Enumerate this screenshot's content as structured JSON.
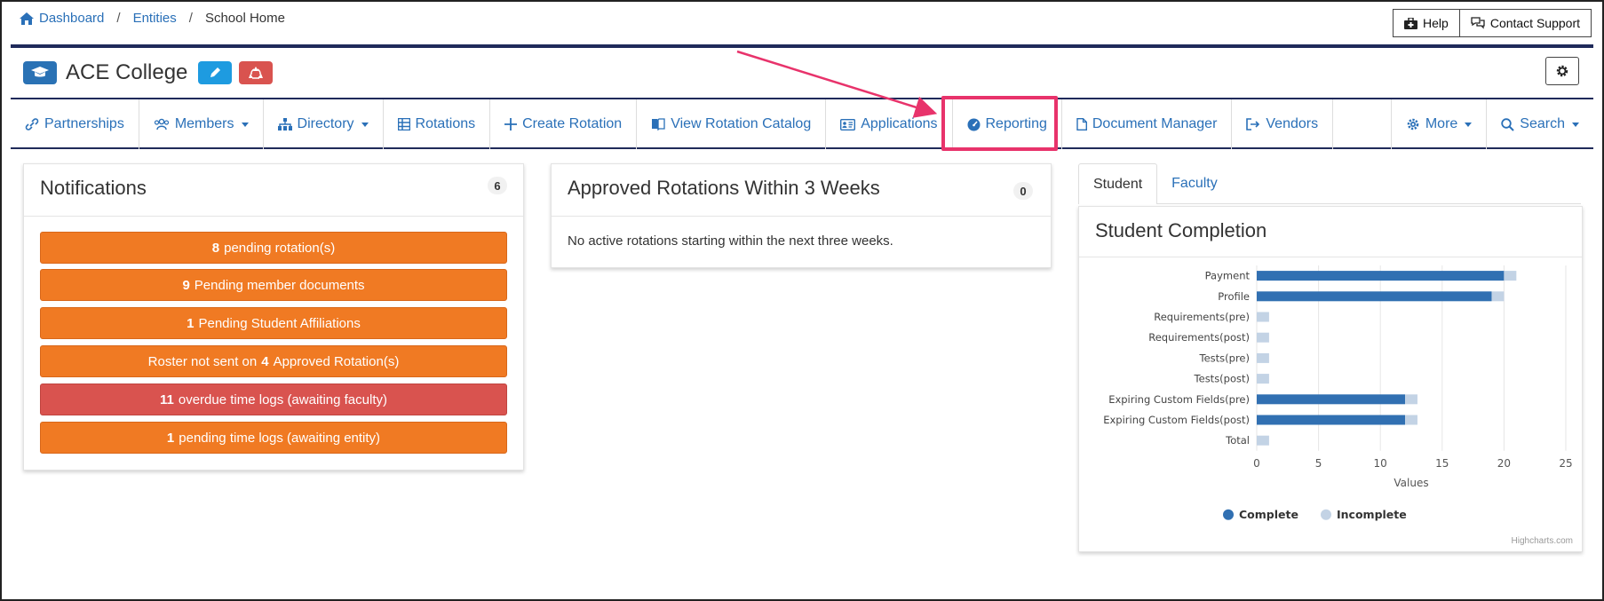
{
  "breadcrumb": {
    "dashboard": "Dashboard",
    "entities": "Entities",
    "current": "School Home",
    "separator": "/"
  },
  "top_buttons": {
    "help": "Help",
    "contact": "Contact Support"
  },
  "school": {
    "name": "ACE College"
  },
  "nav": {
    "partnerships": "Partnerships",
    "members": "Members",
    "directory": "Directory",
    "rotations": "Rotations",
    "create_rotation": "Create Rotation",
    "view_catalog": "View Rotation Catalog",
    "applications": "Applications",
    "reporting": "Reporting",
    "document_manager": "Document Manager",
    "vendors": "Vendors",
    "more": "More",
    "search": "Search"
  },
  "notifications": {
    "title": "Notifications",
    "count": "6",
    "items": [
      {
        "num": "8",
        "text": "pending rotation(s)"
      },
      {
        "num": "9",
        "text": "Pending member documents"
      },
      {
        "num": "1",
        "text": "Pending Student Affiliations"
      },
      {
        "pre": "Roster not sent on",
        "num": "4",
        "text": "Approved Rotation(s)"
      },
      {
        "num": "11",
        "text": "overdue time logs (awaiting faculty)"
      },
      {
        "num": "1",
        "text": "pending time logs (awaiting entity)"
      }
    ]
  },
  "approved": {
    "title": "Approved Rotations Within 3 Weeks",
    "count": "0",
    "message": "No active rotations starting within the next three weeks."
  },
  "tabs": {
    "student": "Student",
    "faculty": "Faculty"
  },
  "completion": {
    "title": "Student Completion",
    "credit": "Highcharts.com"
  },
  "chart_data": {
    "type": "bar",
    "orientation": "horizontal",
    "stacked": true,
    "categories": [
      "Payment",
      "Profile",
      "Requirements(pre)",
      "Requirements(post)",
      "Tests(pre)",
      "Tests(post)",
      "Expiring Custom Fields(pre)",
      "Expiring Custom Fields(post)",
      "Total"
    ],
    "series": [
      {
        "name": "Complete",
        "color": "#3170b2",
        "values": [
          20,
          19,
          0,
          0,
          0,
          0,
          12,
          12,
          0
        ]
      },
      {
        "name": "Incomplete",
        "color": "#c3d3e5",
        "values": [
          1,
          1,
          1,
          1,
          1,
          1,
          1,
          1,
          1
        ]
      }
    ],
    "xlabel": "Values",
    "xlim": [
      0,
      25
    ],
    "ticks": [
      "0",
      "5",
      "10",
      "15",
      "20",
      "25"
    ],
    "grid": true,
    "legend": "bottom-center"
  }
}
